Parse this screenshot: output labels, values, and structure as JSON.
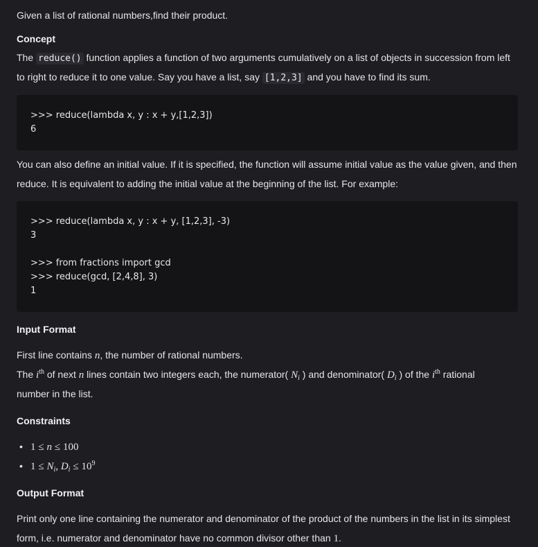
{
  "intro": "Given a list of rational numbers,find their product.",
  "concept": {
    "heading": "Concept",
    "text_a": "The ",
    "code_reduce": "reduce()",
    "text_b": " function applies a function of two arguments cumulatively on a list of objects in succession from left",
    "text_c": "to right to reduce it to one value. Say you have a list, say ",
    "code_list": "[1,2,3]",
    "text_d": " and you have to find its sum."
  },
  "code1": {
    "lines": [
      ">>> reduce(lambda x, y : x + y,[1,2,3])",
      "6"
    ]
  },
  "initial_value": {
    "line1": "You can also define an initial value. If it is specified, the function will assume initial value as the value given, and then",
    "line2": "reduce. It is equivalent to adding the initial value at the beginning of the list. For example:"
  },
  "code2": {
    "lines": [
      ">>> reduce(lambda x, y : x + y, [1,2,3], -3)",
      "3",
      ">>> from fractions import gcd",
      ">>> reduce(gcd, [2,4,8], 3)",
      "1"
    ]
  },
  "input_format": {
    "heading": "Input Format",
    "line1_a": "First line contains ",
    "n": "n",
    "line1_b": ", the number of rational numbers.",
    "line2_a": "The ",
    "i": "i",
    "th": "th",
    "line2_b": " of next ",
    "line2_c": " lines contain two integers each, the numerator( ",
    "N": "N",
    "D": "D",
    "line2_d": " ) and denominator( ",
    "line2_e": " ) of the ",
    "line2_f": " rational",
    "line3": "number in the list."
  },
  "constraints": {
    "heading": "Constraints",
    "bullet": "•",
    "c1_one": "1",
    "c1_le": "≤",
    "c1_n": "n",
    "c1_hundred": "100",
    "c2_one": "1",
    "c2_N": "N",
    "c2_sub": "i",
    "c2_comma": ", ",
    "c2_D": "D",
    "c2_ten": "10",
    "c2_exp": "9"
  },
  "output_format": {
    "heading": "Output Format",
    "line1": "Print only one line containing the numerator and denominator of the product of the numbers in the list in its simplest",
    "line2_a": "form, i.e. numerator and denominator have no common divisor other than ",
    "line2_one": "1",
    "line2_b": "."
  }
}
